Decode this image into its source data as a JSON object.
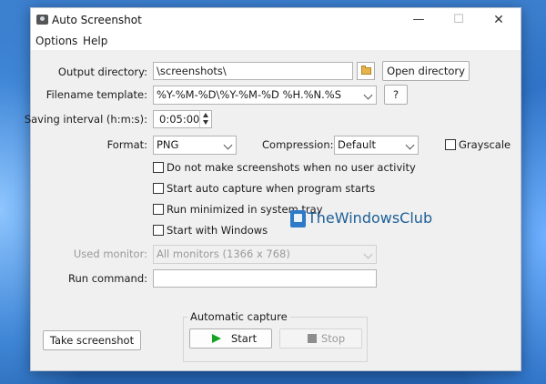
{
  "window": {
    "title": "Auto Screenshot",
    "controls": {
      "minimize": "—",
      "maximize": "☐",
      "close": "✕"
    }
  },
  "menu": {
    "options": "Options",
    "help": "Help"
  },
  "form": {
    "output_directory": {
      "label": "Output directory:",
      "value": "\\screenshots\\",
      "open_button": "Open directory"
    },
    "filename_template": {
      "label": "Filename template:",
      "value": "%Y-%M-%D\\%Y-%M-%D %H.%N.%S",
      "help_button": "?"
    },
    "saving_interval": {
      "label": "Saving interval (h:m:s):",
      "value": "0:05:00"
    },
    "format": {
      "label": "Format:",
      "value": "PNG"
    },
    "compression": {
      "label": "Compression:",
      "value": "Default"
    },
    "grayscale": {
      "label": "Grayscale",
      "checked": false
    },
    "checkboxes": [
      {
        "label": "Do not make screenshots when no user activity",
        "checked": false
      },
      {
        "label": "Start auto capture when program starts",
        "checked": false
      },
      {
        "label": "Run minimized in system tray",
        "checked": false
      },
      {
        "label": "Start with Windows",
        "checked": false
      }
    ],
    "used_monitor": {
      "label": "Used monitor:",
      "value": "All monitors (1366 x 768)"
    },
    "run_command": {
      "label": "Run command:",
      "value": ""
    }
  },
  "actions": {
    "take_screenshot": "Take screenshot",
    "automatic_capture": {
      "title": "Automatic capture",
      "start": "Start",
      "stop": "Stop"
    }
  },
  "watermark": {
    "text": "TheWindowsClub"
  },
  "colors": {
    "accent_play": "#17a323",
    "stop_disabled": "#8d8d8d",
    "watermark": "#1d5f97"
  },
  "icons": [
    "app-camera-icon",
    "folder-icon",
    "chevron-down-icon",
    "spin-up-icon",
    "spin-down-icon",
    "play-icon",
    "stop-icon",
    "watermark-logo-icon"
  ]
}
